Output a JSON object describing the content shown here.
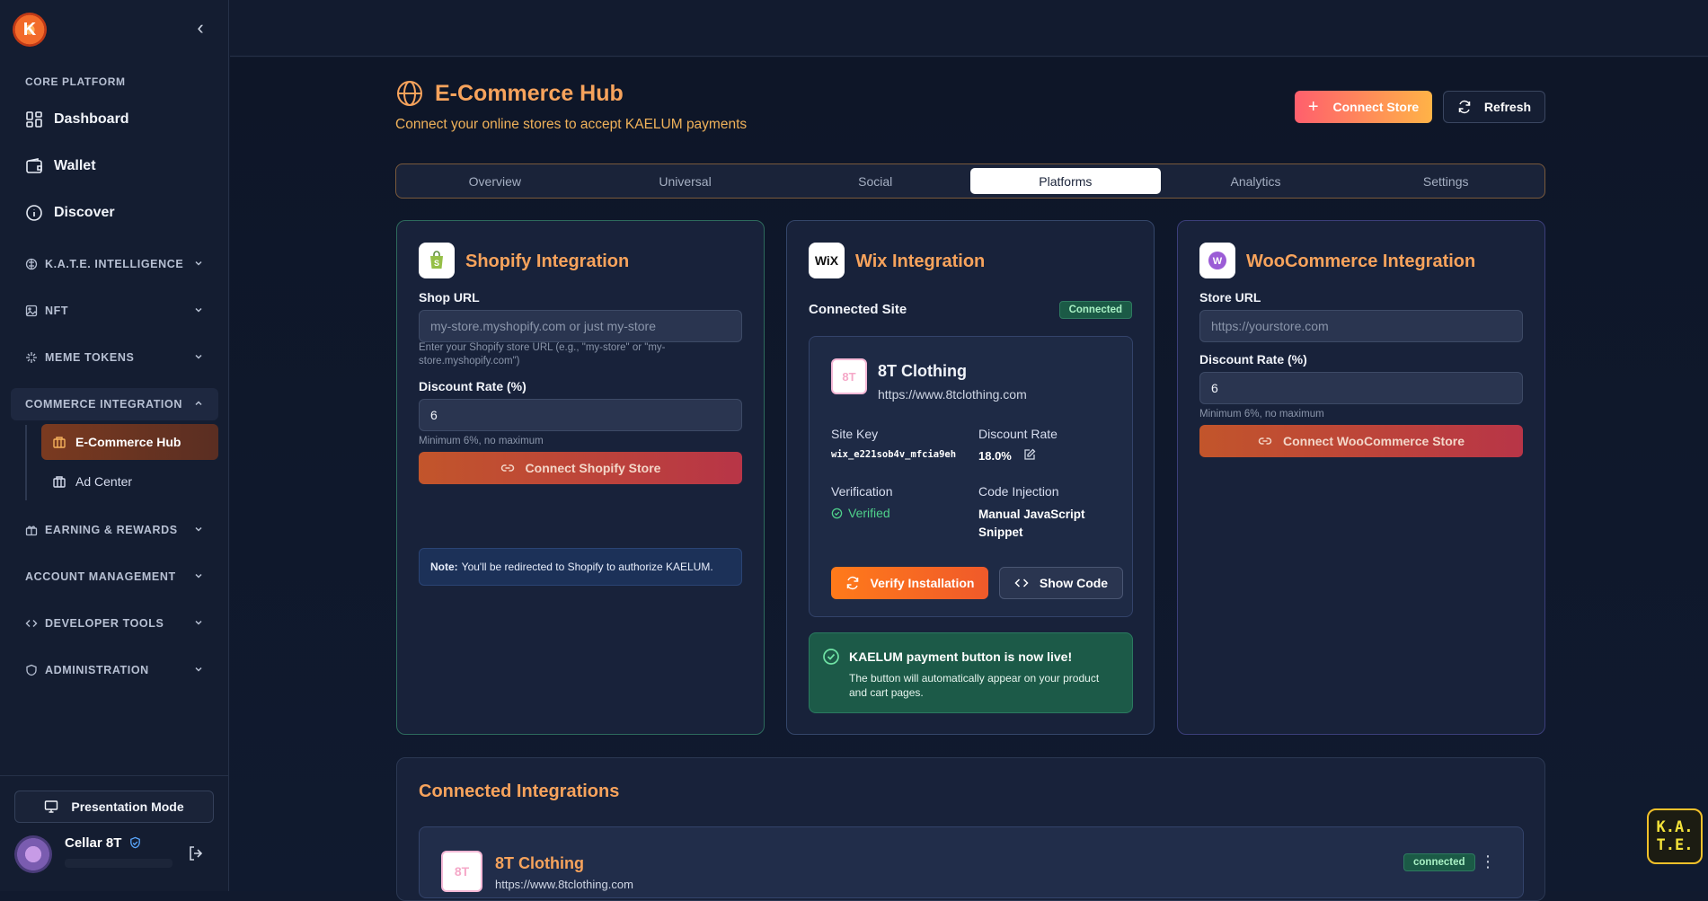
{
  "sidebar": {
    "logo_letter": "K",
    "core_label": "CORE PLATFORM",
    "main_items": [
      {
        "label": "Dashboard",
        "icon": "dashboard-icon"
      },
      {
        "label": "Wallet",
        "icon": "wallet-icon"
      },
      {
        "label": "Discover",
        "icon": "info-icon"
      }
    ],
    "groups": [
      {
        "label": "K.A.T.E. INTELLIGENCE",
        "icon": "brain-icon"
      },
      {
        "label": "NFT",
        "icon": "image-icon"
      },
      {
        "label": "MEME TOKENS",
        "icon": "sparkle-icon"
      },
      {
        "label": "COMMERCE INTEGRATION",
        "icon": ""
      },
      {
        "label": "EARNING & REWARDS",
        "icon": "gift-icon"
      },
      {
        "label": "ACCOUNT MANAGEMENT",
        "icon": ""
      },
      {
        "label": "DEVELOPER TOOLS",
        "icon": "code-icon"
      },
      {
        "label": "ADMINISTRATION",
        "icon": "shield-icon"
      }
    ],
    "sub_items": [
      {
        "label": "E-Commerce Hub",
        "active": true
      },
      {
        "label": "Ad Center",
        "active": false
      }
    ],
    "presentation_label": "Presentation Mode",
    "user_name": "Cellar 8T"
  },
  "header": {
    "title": "E-Commerce Hub",
    "subtitle": "Connect your online stores to accept KAELUM payments",
    "connect_label": "Connect Store",
    "refresh_label": "Refresh"
  },
  "tabs": [
    "Overview",
    "Universal",
    "Social",
    "Platforms",
    "Analytics",
    "Settings"
  ],
  "active_tab": "Platforms",
  "shopify": {
    "logo_text": "S",
    "title": "Shopify Integration",
    "shop_url_label": "Shop URL",
    "shop_url_placeholder": "my-store.myshopify.com or just my-store",
    "shop_url_hint": "Enter your Shopify store URL (e.g., \"my-store\" or \"my-store.myshopify.com\")",
    "discount_label": "Discount Rate (%)",
    "discount_value": "6",
    "discount_hint": "Minimum 6%, no maximum",
    "button_label": "Connect Shopify Store",
    "note_bold": "Note:",
    "note_text": "You'll be redirected to Shopify to authorize KAELUM."
  },
  "wix": {
    "logo_text": "WiX",
    "title": "Wix Integration",
    "connected_site_label": "Connected Site",
    "status_badge": "Connected",
    "site_logo_text": "8T",
    "site_name": "8T Clothing",
    "site_url": "https://www.8tclothing.com",
    "site_key_label": "Site Key",
    "site_key_value": "wix_e221sob4v_mfcia9eh",
    "discount_rate_label": "Discount Rate",
    "discount_rate_value": "18.0%",
    "verification_label": "Verification",
    "verification_value": "Verified",
    "code_injection_label": "Code Injection",
    "code_injection_value": "Manual JavaScript Snippet",
    "verify_button": "Verify Installation",
    "code_button": "Show Code",
    "live_title": "KAELUM payment button is now live!",
    "live_desc": "The button will automatically appear on your product and cart pages."
  },
  "woo": {
    "logo_text": "W",
    "title": "WooCommerce Integration",
    "store_url_label": "Store URL",
    "store_url_placeholder": "https://yourstore.com",
    "discount_label": "Discount Rate (%)",
    "discount_value": "6",
    "discount_hint": "Minimum 6%, no maximum",
    "button_label": "Connect WooCommerce Store"
  },
  "connected": {
    "title": "Connected Integrations",
    "items": [
      {
        "logo_text": "8T",
        "name": "8T Clothing",
        "url": "https://www.8tclothing.com",
        "status": "connected"
      }
    ]
  },
  "kate_badge": {
    "line1": "K.A.",
    "line2": "T.E."
  }
}
